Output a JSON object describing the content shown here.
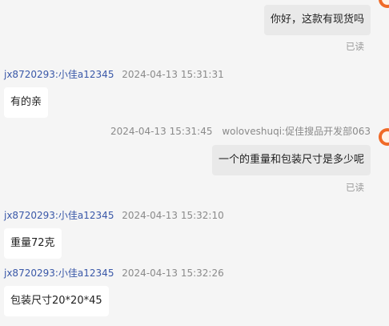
{
  "messages": [
    {
      "dir": "out",
      "text": "你好，这款有现货吗",
      "status": "已读"
    },
    {
      "dir": "in",
      "sender": "jx8720293:小佳a12345",
      "time": "2024-04-13 15:31:31",
      "text": "有的亲"
    },
    {
      "dir": "out",
      "sender": "woloveshuqi:促佳搜品开发部063",
      "time": "2024-04-13 15:31:45",
      "text": "一个的重量和包装尺寸是多少呢",
      "status": "已读"
    },
    {
      "dir": "in",
      "sender": "jx8720293:小佳a12345",
      "time": "2024-04-13 15:32:10",
      "text": "重量72克"
    },
    {
      "dir": "in",
      "sender": "jx8720293:小佳a12345",
      "time": "2024-04-13 15:32:26",
      "text": "包装尺寸20*20*45"
    }
  ],
  "colors": {
    "background": "#f5f5f5",
    "outgoing_bubble": "#e9e9e9",
    "incoming_bubble": "#ffffff",
    "sender_name": "#3a58a8",
    "avatar": "#f06a28"
  }
}
